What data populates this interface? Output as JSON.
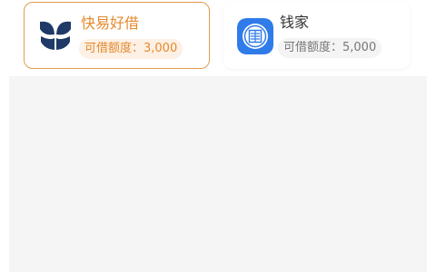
{
  "lenders": [
    {
      "name": "快易好借",
      "quota": "可借额度：3,000",
      "icon": "kuaiyi-logo-icon",
      "brand_color": "#1f3a66",
      "selected": true
    },
    {
      "name": "钱家",
      "quota": "可借额度：5,000",
      "icon": "qianjia-logo-icon",
      "brand_color": "#2f7bea",
      "selected": false
    }
  ],
  "colors": {
    "accent": "#e48a2e",
    "content_bg": "#f5f5f5"
  }
}
